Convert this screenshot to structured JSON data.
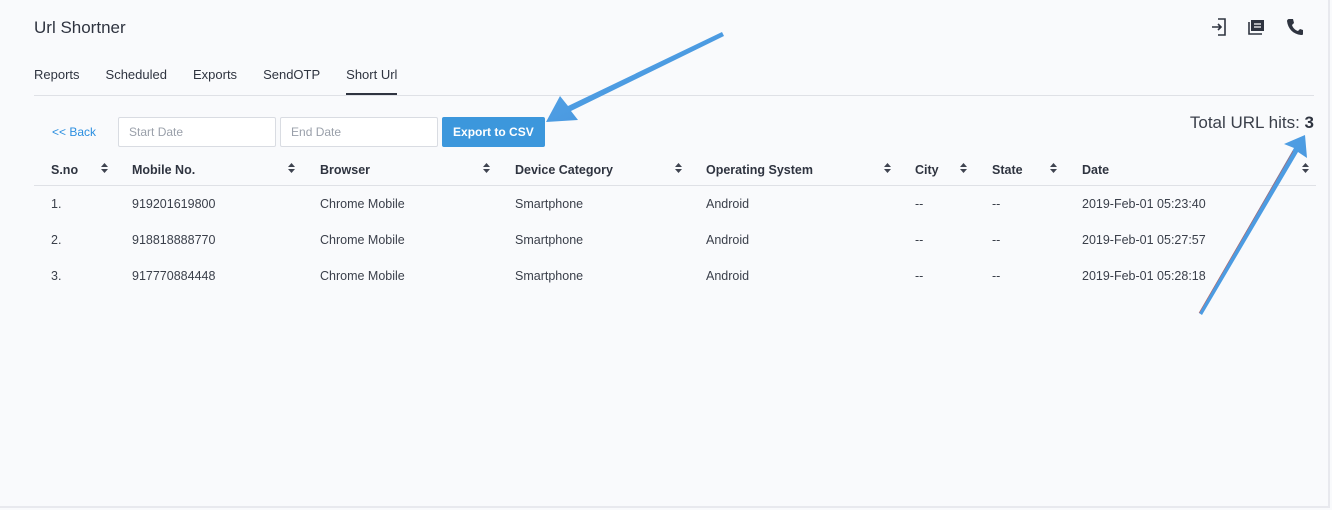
{
  "app": {
    "title": "Url Shortner"
  },
  "header_icons": [
    "logout-icon",
    "notes-icon",
    "phone-icon"
  ],
  "tabs": [
    {
      "label": "Reports",
      "active": false
    },
    {
      "label": "Scheduled",
      "active": false
    },
    {
      "label": "Exports",
      "active": false
    },
    {
      "label": "SendOTP",
      "active": false
    },
    {
      "label": "Short Url",
      "active": true
    }
  ],
  "toolbar": {
    "back_label": "<< Back",
    "start_date_placeholder": "Start Date",
    "end_date_placeholder": "End Date",
    "export_label": "Export to CSV"
  },
  "summary": {
    "label": "Total URL hits:",
    "value": "3"
  },
  "table": {
    "columns": [
      "S.no",
      "Mobile No.",
      "Browser",
      "Device Category",
      "Operating System",
      "City",
      "State",
      "Date"
    ],
    "rows": [
      [
        "1.",
        "919201619800",
        "Chrome Mobile",
        "Smartphone",
        "Android",
        "--",
        "--",
        "2019-Feb-01 05:23:40"
      ],
      [
        "2.",
        "918818888770",
        "Chrome Mobile",
        "Smartphone",
        "Android",
        "--",
        "--",
        "2019-Feb-01 05:27:57"
      ],
      [
        "3.",
        "917770884448",
        "Chrome Mobile",
        "Smartphone",
        "Android",
        "--",
        "--",
        "2019-Feb-01 05:28:18"
      ]
    ]
  },
  "colors": {
    "accent": "#3c97dc",
    "link": "#2c8fe0",
    "annotation_arrow": "#4a9ee6"
  }
}
